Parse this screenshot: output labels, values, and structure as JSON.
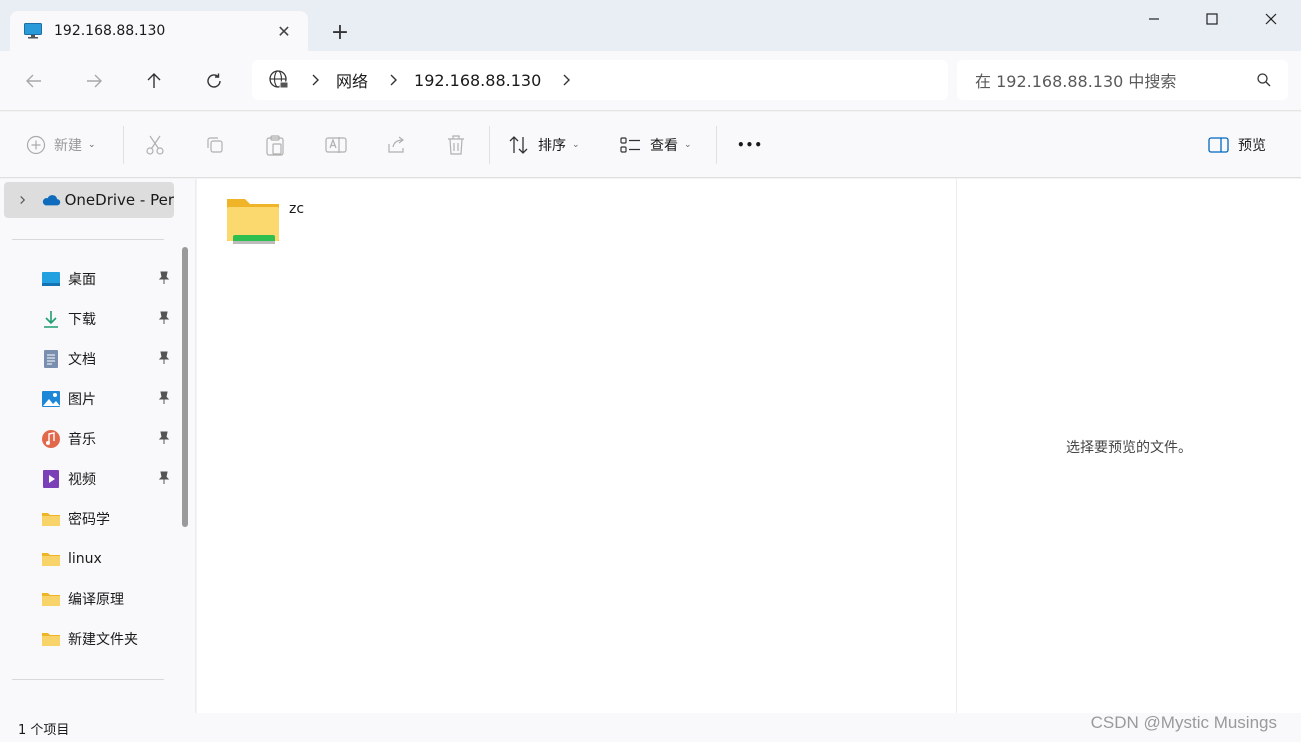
{
  "tab": {
    "title": "192.168.88.130",
    "icon": "monitor-icon",
    "close": "✕"
  },
  "window": {
    "new_tab": "+"
  },
  "address": {
    "crumbs": [
      "网络",
      "192.168.88.130"
    ],
    "search_placeholder": "在 192.168.88.130 中搜索"
  },
  "toolbar": {
    "new_label": "新建",
    "sort_label": "排序",
    "view_label": "查看",
    "more_label": "•••",
    "preview_label": "预览"
  },
  "sidebar": {
    "onedrive": "OneDrive - Per",
    "items": [
      {
        "label": "桌面",
        "icon": "desktop-icon",
        "pinned": true
      },
      {
        "label": "下载",
        "icon": "download-icon",
        "pinned": true
      },
      {
        "label": "文档",
        "icon": "document-icon",
        "pinned": true
      },
      {
        "label": "图片",
        "icon": "pictures-icon",
        "pinned": true
      },
      {
        "label": "音乐",
        "icon": "music-icon",
        "pinned": true
      },
      {
        "label": "视频",
        "icon": "video-icon",
        "pinned": true
      },
      {
        "label": "密码学",
        "icon": "folder-icon",
        "pinned": false
      },
      {
        "label": "linux",
        "icon": "folder-icon",
        "pinned": false
      },
      {
        "label": "编译原理",
        "icon": "folder-icon",
        "pinned": false
      },
      {
        "label": "新建文件夹",
        "icon": "folder-icon",
        "pinned": false
      }
    ]
  },
  "content": {
    "files": [
      {
        "name": "zc",
        "icon": "network-folder-icon"
      }
    ]
  },
  "preview": {
    "message": "选择要预览的文件。"
  },
  "status": {
    "count": "1 个项目"
  },
  "watermark": "CSDN @Mystic Musings",
  "colors": {
    "accent": "#0067c0",
    "folder": "#f8c84a",
    "share": "#2fbf4f"
  }
}
